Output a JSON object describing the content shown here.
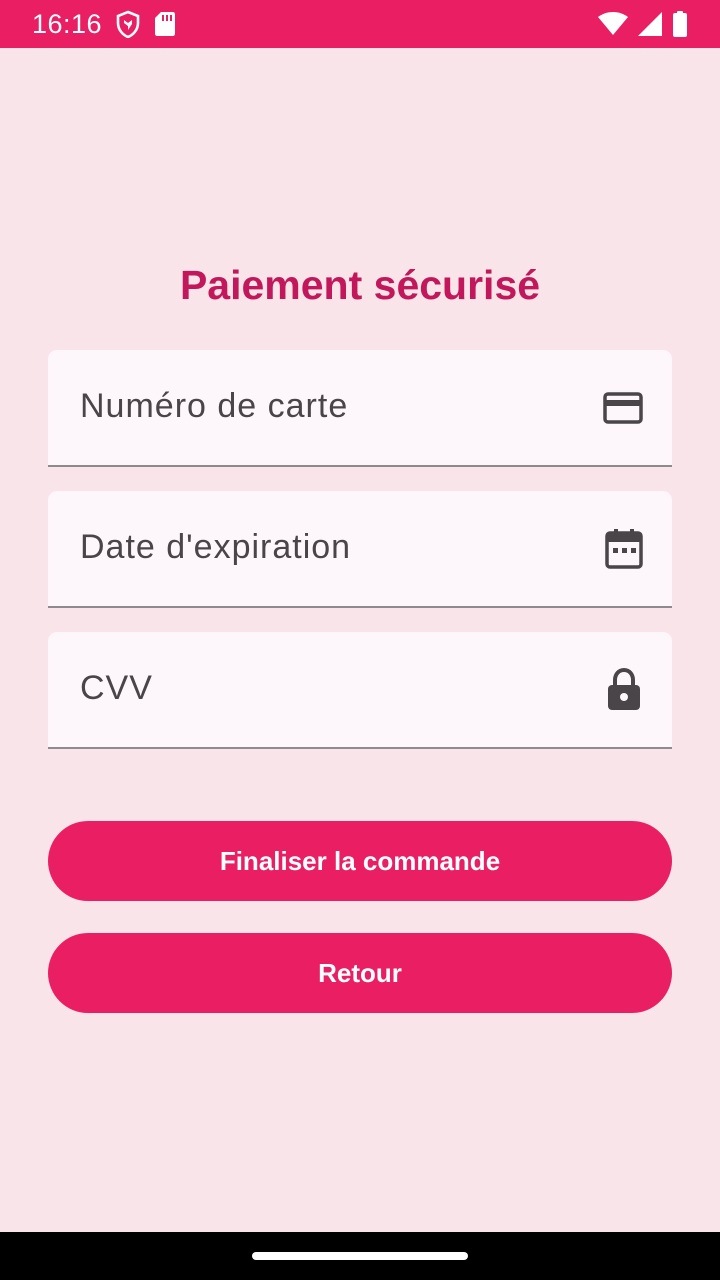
{
  "status_bar": {
    "time": "16:16",
    "icons": [
      "shield-icon",
      "sd-card-icon",
      "wifi-icon",
      "signal-icon",
      "battery-icon"
    ],
    "background_color": "#E91E63"
  },
  "page": {
    "title": "Paiement sécurisé",
    "title_color": "#C2185B",
    "background_color": "#F9E4EA"
  },
  "fields": {
    "card_number": {
      "placeholder": "Numéro de carte",
      "value": "",
      "icon": "credit-card-icon"
    },
    "expiry_date": {
      "placeholder": "Date d'expiration",
      "value": "",
      "icon": "calendar-icon"
    },
    "cvv": {
      "placeholder": "CVV",
      "value": "",
      "icon": "lock-icon"
    }
  },
  "buttons": {
    "finalize_label": "Finaliser la commande",
    "back_label": "Retour",
    "color": "#E91E63"
  }
}
